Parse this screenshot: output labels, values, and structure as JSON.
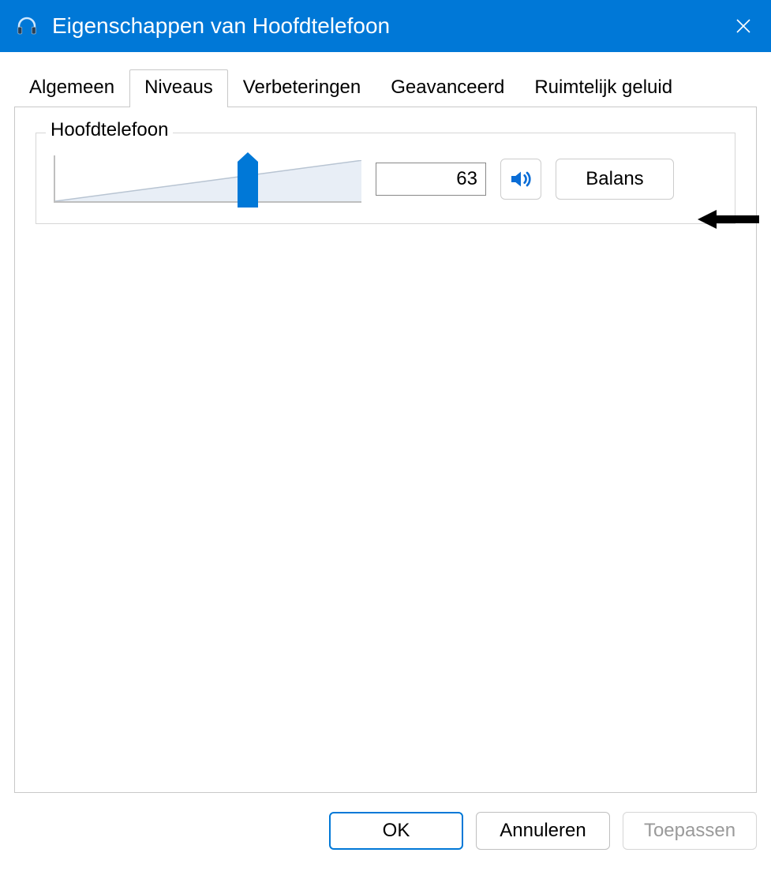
{
  "titlebar": {
    "title": "Eigenschappen van Hoofdtelefoon"
  },
  "tabs": [
    {
      "label": "Algemeen",
      "active": false
    },
    {
      "label": "Niveaus",
      "active": true
    },
    {
      "label": "Verbeteringen",
      "active": false
    },
    {
      "label": "Geavanceerd",
      "active": false
    },
    {
      "label": "Ruimtelijk geluid",
      "active": false
    }
  ],
  "levels": {
    "group_title": "Hoofdtelefoon",
    "value": "63",
    "slider_percent": 63,
    "balance_label": "Balans"
  },
  "buttons": {
    "ok": "OK",
    "cancel": "Annuleren",
    "apply": "Toepassen"
  }
}
